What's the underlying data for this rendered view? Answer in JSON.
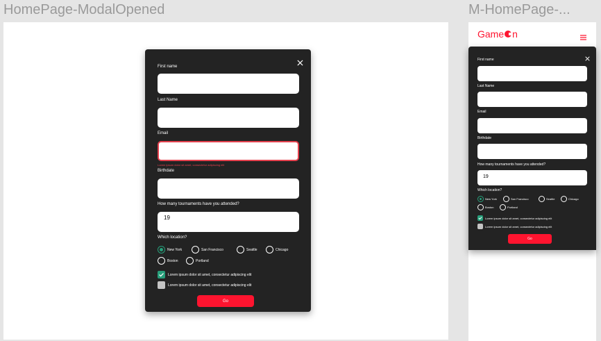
{
  "frames": {
    "desktop_title": "HomePage-ModalOpened",
    "mobile_title": "M-HomePage-..."
  },
  "brand": {
    "logo_text_1": "Game",
    "logo_text_2": "n",
    "accent": "#fe142f"
  },
  "form": {
    "first_name_label": "First name",
    "last_name_label": "Last Name",
    "email_label": "Email",
    "error_message": "Lorem ipsum dolor sit amet, consectetur adipiscing elit",
    "birthdate_label": "Birthdate",
    "tournaments_label": "How many tournaments have you attended?",
    "tournaments_value": "19",
    "location_label": "Which location?",
    "locations": [
      "New York",
      "San Francisco",
      "Seattle",
      "Chicago",
      "Boston",
      "Portland"
    ],
    "selected_location": "New York",
    "checkbox_1": "Lorem ipsum dolor sit amet, consectetur adipiscing elit",
    "checkbox_2": "Lorem ipsum dolor sit amet, consectetur adipiscing elit",
    "checkbox_1_checked": true,
    "checkbox_2_checked": false,
    "submit_label": "Go"
  },
  "icons": {
    "close": "close-icon",
    "menu": "hamburger-menu-icon",
    "check": "checkmark-icon"
  },
  "colors": {
    "modal_bg": "#232323",
    "error": "#e5414e",
    "success": "#279e7a",
    "button": "#fe142f"
  }
}
